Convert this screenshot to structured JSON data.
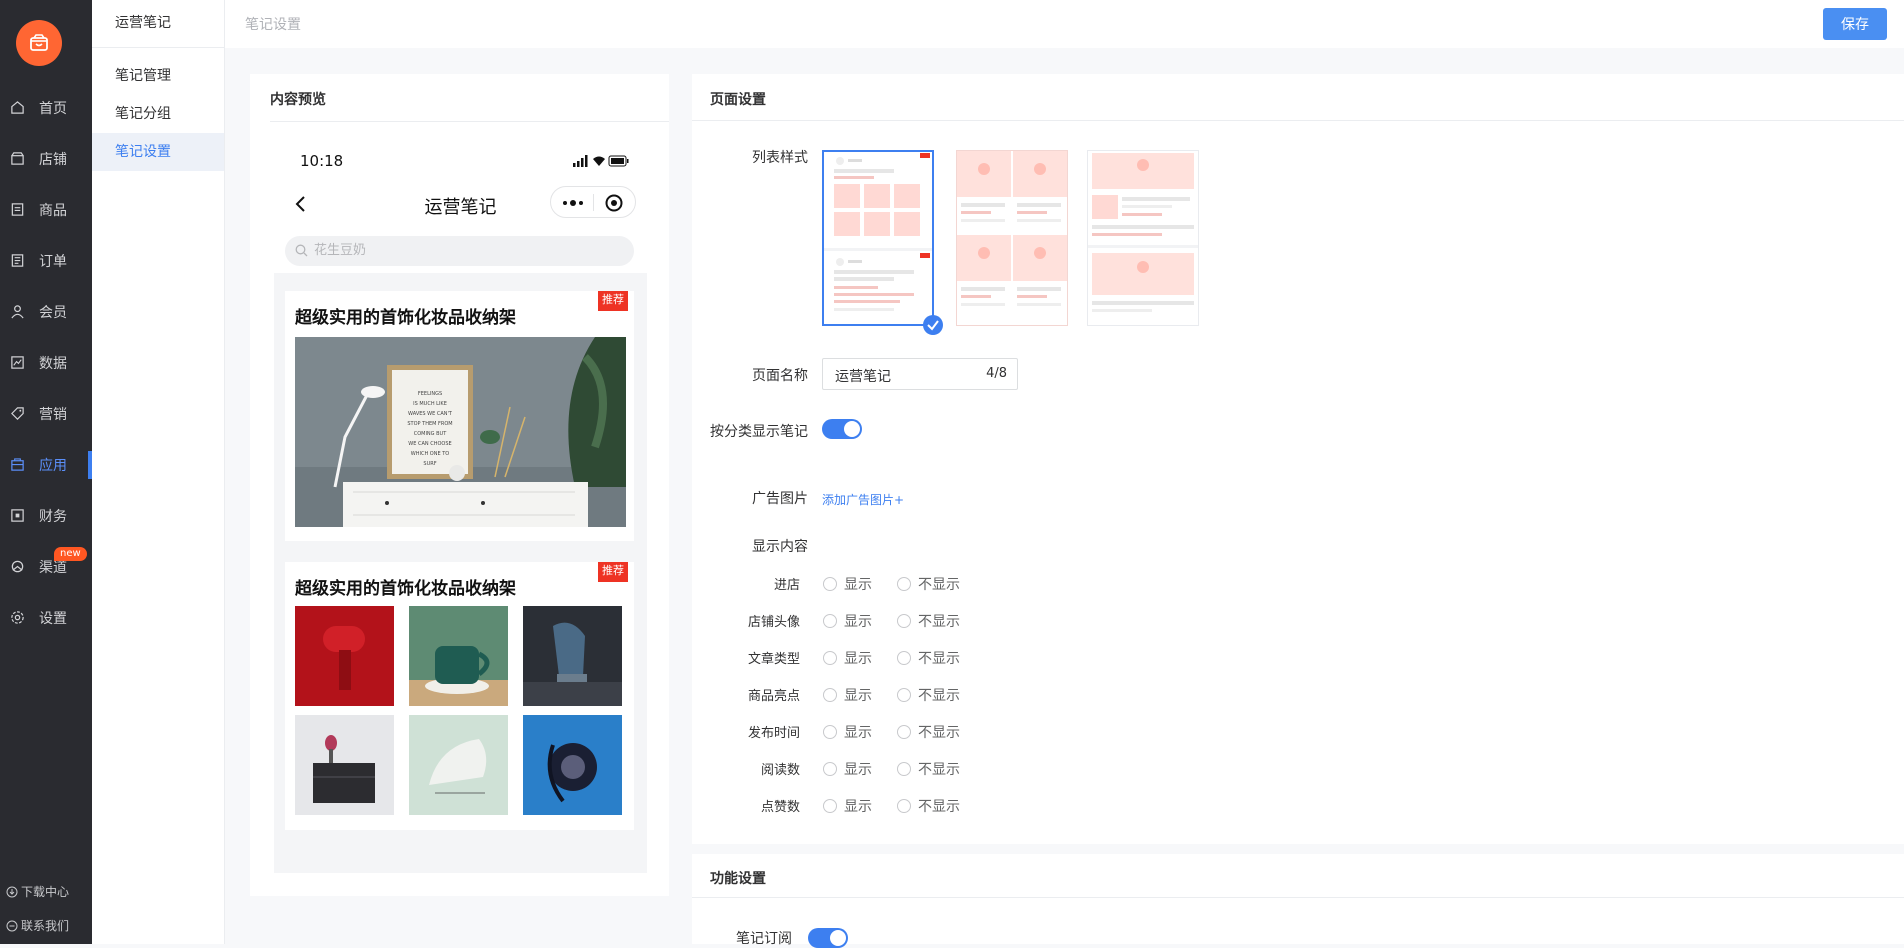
{
  "app": {
    "logo_icon": "shop-bag-icon",
    "accent": "#3d7ff0",
    "brand": "#ff6633"
  },
  "sidebar": {
    "items": [
      {
        "label": "首页",
        "icon": "home-icon"
      },
      {
        "label": "店铺",
        "icon": "store-icon"
      },
      {
        "label": "商品",
        "icon": "goods-icon"
      },
      {
        "label": "订单",
        "icon": "order-icon"
      },
      {
        "label": "会员",
        "icon": "member-icon"
      },
      {
        "label": "数据",
        "icon": "data-icon"
      },
      {
        "label": "营销",
        "icon": "marketing-icon"
      },
      {
        "label": "应用",
        "icon": "apps-icon"
      },
      {
        "label": "财务",
        "icon": "finance-icon"
      },
      {
        "label": "渠道",
        "icon": "channel-icon"
      },
      {
        "label": "设置",
        "icon": "settings-icon"
      }
    ],
    "active": "应用",
    "channel_badge": "new",
    "download": "下载中心",
    "contact": "联系我们"
  },
  "subnav": {
    "title": "运营笔记",
    "items": [
      "笔记管理",
      "笔记分组",
      "笔记设置"
    ],
    "active": "笔记设置"
  },
  "header": {
    "breadcrumb": "笔记设置",
    "save_label": "保存"
  },
  "preview": {
    "title": "内容预览",
    "time": "10:18",
    "nav_title": "运营笔记",
    "search_placeholder": "花生豆奶",
    "posts": [
      {
        "title": "超级实用的首饰化妆品收纳架",
        "tag": "推荐"
      },
      {
        "title": "超级实用的首饰化妆品收纳架",
        "tag": "推荐"
      }
    ],
    "poster_text": "FEELINGS IS MUCH LIKE WAVES WE CAN'T STOP THEM FROM COMING BUT WE CAN CHOOSE WHICH ONE TO SURF"
  },
  "page_settings": {
    "title": "页面设置",
    "list_style_label": "列表样式",
    "page_name_label": "页面名称",
    "page_name_value": "运营笔记",
    "page_name_count": "4/8",
    "by_category_label": "按分类显示笔记",
    "ad_image_label": "广告图片",
    "add_ad_link": "添加广告图片+",
    "display_content_label": "显示内容",
    "show_label": "显示",
    "hide_label": "不显示",
    "display_rows": [
      "进店",
      "店铺头像",
      "文章类型",
      "商品亮点",
      "发布时间",
      "阅读数",
      "点赞数"
    ]
  },
  "function_settings": {
    "title": "功能设置",
    "subscribe_label": "笔记订阅"
  }
}
